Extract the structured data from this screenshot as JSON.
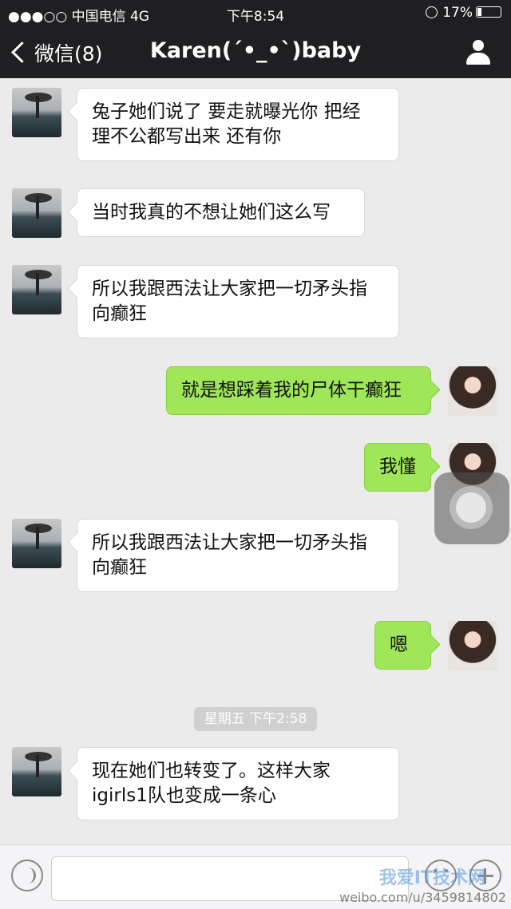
{
  "status_bar": {
    "carrier": "●●●○○ 中国电信  4G",
    "time": "下午8:54",
    "battery": "17%"
  },
  "nav": {
    "back_label": "微信(8)",
    "title": "Karen(´•_•`)baby"
  },
  "messages": [
    {
      "side": "left",
      "text": "兔子她们说了 要走就曝光你 把经\n理不公都写出来 还有你"
    },
    {
      "side": "left",
      "text": "当时我真的不想让她们这么写"
    },
    {
      "side": "left",
      "text": "所以我跟西法让大家把一切矛头指\n向癫狂"
    },
    {
      "side": "right",
      "text": "就是想踩着我的尸体干癫狂"
    },
    {
      "side": "right",
      "text": "我懂"
    },
    {
      "side": "left",
      "text": "所以我跟西法让大家把一切矛头指\n向癫狂"
    },
    {
      "side": "right",
      "text": "嗯"
    },
    {
      "side": "left",
      "text": "现在她们也转变了。这样大家\nigirls1队也变成一条心"
    }
  ],
  "timestamp": "星期五 下午2:58",
  "watermark": {
    "site": "我爱IT技术网",
    "url": "weibo.com/u/3459814802"
  },
  "colors": {
    "nav_bg": "#1f1f22",
    "chat_bg": "#ebebeb",
    "my_bubble": "#9fe658",
    "their_bubble": "#ffffff"
  },
  "icons": [
    "back-chevron-icon",
    "contact-person-icon",
    "voice-icon",
    "emoji-icon",
    "plus-icon",
    "assistive-touch-icon"
  ]
}
